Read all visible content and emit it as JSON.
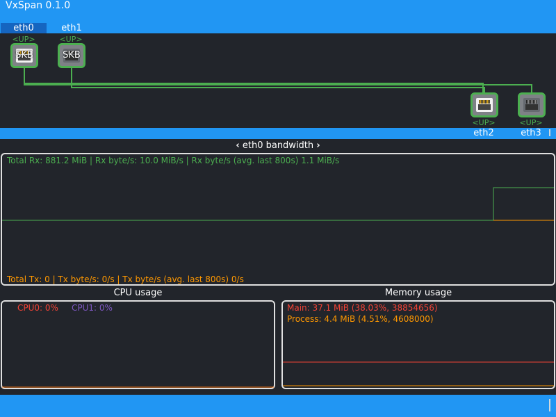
{
  "app": {
    "title": "VxSpan 0.1.0"
  },
  "tabs": [
    {
      "label": "eth0",
      "active": true
    },
    {
      "label": "eth1",
      "active": false
    }
  ],
  "topology": {
    "top_ports": [
      {
        "name": "eth0",
        "status": "<UP>",
        "badge": "SKB",
        "style": "light"
      },
      {
        "name": "eth1",
        "status": "<UP>",
        "badge": "SKB",
        "style": "dark"
      }
    ],
    "bottom_ports": [
      {
        "name": "eth2",
        "status": "<UP>",
        "style": "light"
      },
      {
        "name": "eth3",
        "status": "<UP>",
        "style": "dark"
      }
    ],
    "link_color": "#4caf50"
  },
  "bandwidth": {
    "prev_icon": "chevron-left-icon",
    "next_icon": "chevron-right-icon",
    "title": "eth0 bandwidth",
    "rx_text": "Total Rx: 881.2 MiB | Rx byte/s: 10.0 MiB/s | Rx byte/s (avg. last 800s) 1.1 MiB/s",
    "tx_text": "Total Tx: 0 | Tx byte/s: 0/s | Tx byte/s (avg. last 800s) 0/s",
    "rx_color": "#4caf50",
    "tx_color": "#ff9800"
  },
  "cpu": {
    "title": "CPU usage",
    "items": [
      {
        "label": "CPU0: 0%",
        "color": "#f44336"
      },
      {
        "label": "CPU1: 0%",
        "color": "#673ab7"
      }
    ]
  },
  "memory": {
    "title": "Memory usage",
    "items": [
      {
        "label": "Main: 37.1 MiB (38.03%, 38854656)",
        "color": "#f44336"
      },
      {
        "label": "Process: 4.4 MiB (4.51%, 4608000)",
        "color": "#ff9800"
      }
    ]
  },
  "colors": {
    "accent": "#2196f3",
    "background": "#22252b",
    "panel_border": "#e0e0e0"
  }
}
